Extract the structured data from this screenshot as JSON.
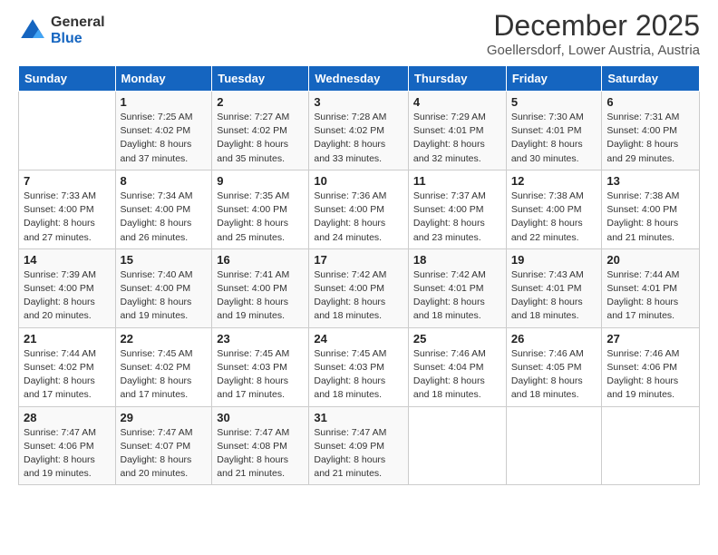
{
  "logo": {
    "general": "General",
    "blue": "Blue"
  },
  "header": {
    "title": "December 2025",
    "subtitle": "Goellersdorf, Lower Austria, Austria"
  },
  "weekdays": [
    "Sunday",
    "Monday",
    "Tuesday",
    "Wednesday",
    "Thursday",
    "Friday",
    "Saturday"
  ],
  "weeks": [
    [
      {
        "day": "",
        "info": ""
      },
      {
        "day": "1",
        "info": "Sunrise: 7:25 AM\nSunset: 4:02 PM\nDaylight: 8 hours\nand 37 minutes."
      },
      {
        "day": "2",
        "info": "Sunrise: 7:27 AM\nSunset: 4:02 PM\nDaylight: 8 hours\nand 35 minutes."
      },
      {
        "day": "3",
        "info": "Sunrise: 7:28 AM\nSunset: 4:02 PM\nDaylight: 8 hours\nand 33 minutes."
      },
      {
        "day": "4",
        "info": "Sunrise: 7:29 AM\nSunset: 4:01 PM\nDaylight: 8 hours\nand 32 minutes."
      },
      {
        "day": "5",
        "info": "Sunrise: 7:30 AM\nSunset: 4:01 PM\nDaylight: 8 hours\nand 30 minutes."
      },
      {
        "day": "6",
        "info": "Sunrise: 7:31 AM\nSunset: 4:00 PM\nDaylight: 8 hours\nand 29 minutes."
      }
    ],
    [
      {
        "day": "7",
        "info": "Sunrise: 7:33 AM\nSunset: 4:00 PM\nDaylight: 8 hours\nand 27 minutes."
      },
      {
        "day": "8",
        "info": "Sunrise: 7:34 AM\nSunset: 4:00 PM\nDaylight: 8 hours\nand 26 minutes."
      },
      {
        "day": "9",
        "info": "Sunrise: 7:35 AM\nSunset: 4:00 PM\nDaylight: 8 hours\nand 25 minutes."
      },
      {
        "day": "10",
        "info": "Sunrise: 7:36 AM\nSunset: 4:00 PM\nDaylight: 8 hours\nand 24 minutes."
      },
      {
        "day": "11",
        "info": "Sunrise: 7:37 AM\nSunset: 4:00 PM\nDaylight: 8 hours\nand 23 minutes."
      },
      {
        "day": "12",
        "info": "Sunrise: 7:38 AM\nSunset: 4:00 PM\nDaylight: 8 hours\nand 22 minutes."
      },
      {
        "day": "13",
        "info": "Sunrise: 7:38 AM\nSunset: 4:00 PM\nDaylight: 8 hours\nand 21 minutes."
      }
    ],
    [
      {
        "day": "14",
        "info": "Sunrise: 7:39 AM\nSunset: 4:00 PM\nDaylight: 8 hours\nand 20 minutes."
      },
      {
        "day": "15",
        "info": "Sunrise: 7:40 AM\nSunset: 4:00 PM\nDaylight: 8 hours\nand 19 minutes."
      },
      {
        "day": "16",
        "info": "Sunrise: 7:41 AM\nSunset: 4:00 PM\nDaylight: 8 hours\nand 19 minutes."
      },
      {
        "day": "17",
        "info": "Sunrise: 7:42 AM\nSunset: 4:00 PM\nDaylight: 8 hours\nand 18 minutes."
      },
      {
        "day": "18",
        "info": "Sunrise: 7:42 AM\nSunset: 4:01 PM\nDaylight: 8 hours\nand 18 minutes."
      },
      {
        "day": "19",
        "info": "Sunrise: 7:43 AM\nSunset: 4:01 PM\nDaylight: 8 hours\nand 18 minutes."
      },
      {
        "day": "20",
        "info": "Sunrise: 7:44 AM\nSunset: 4:01 PM\nDaylight: 8 hours\nand 17 minutes."
      }
    ],
    [
      {
        "day": "21",
        "info": "Sunrise: 7:44 AM\nSunset: 4:02 PM\nDaylight: 8 hours\nand 17 minutes."
      },
      {
        "day": "22",
        "info": "Sunrise: 7:45 AM\nSunset: 4:02 PM\nDaylight: 8 hours\nand 17 minutes."
      },
      {
        "day": "23",
        "info": "Sunrise: 7:45 AM\nSunset: 4:03 PM\nDaylight: 8 hours\nand 17 minutes."
      },
      {
        "day": "24",
        "info": "Sunrise: 7:45 AM\nSunset: 4:03 PM\nDaylight: 8 hours\nand 18 minutes."
      },
      {
        "day": "25",
        "info": "Sunrise: 7:46 AM\nSunset: 4:04 PM\nDaylight: 8 hours\nand 18 minutes."
      },
      {
        "day": "26",
        "info": "Sunrise: 7:46 AM\nSunset: 4:05 PM\nDaylight: 8 hours\nand 18 minutes."
      },
      {
        "day": "27",
        "info": "Sunrise: 7:46 AM\nSunset: 4:06 PM\nDaylight: 8 hours\nand 19 minutes."
      }
    ],
    [
      {
        "day": "28",
        "info": "Sunrise: 7:47 AM\nSunset: 4:06 PM\nDaylight: 8 hours\nand 19 minutes."
      },
      {
        "day": "29",
        "info": "Sunrise: 7:47 AM\nSunset: 4:07 PM\nDaylight: 8 hours\nand 20 minutes."
      },
      {
        "day": "30",
        "info": "Sunrise: 7:47 AM\nSunset: 4:08 PM\nDaylight: 8 hours\nand 21 minutes."
      },
      {
        "day": "31",
        "info": "Sunrise: 7:47 AM\nSunset: 4:09 PM\nDaylight: 8 hours\nand 21 minutes."
      },
      {
        "day": "",
        "info": ""
      },
      {
        "day": "",
        "info": ""
      },
      {
        "day": "",
        "info": ""
      }
    ]
  ]
}
